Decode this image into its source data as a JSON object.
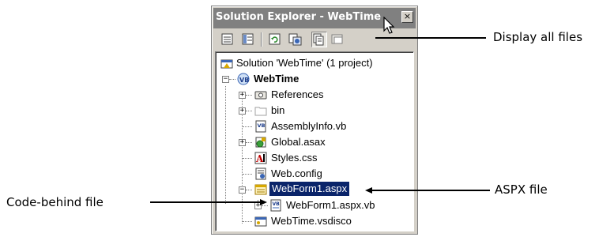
{
  "window": {
    "title": "Solution Explorer - WebTime",
    "close_glyph": "×"
  },
  "toolbar": {
    "buttons": [
      "properties-icon",
      "show-details-icon",
      "refresh-icon",
      "copy-project-icon",
      "display-all-files-icon",
      "nest-related-files-icon"
    ]
  },
  "tree": {
    "solution": "Solution 'WebTime' (1 project)",
    "project": "WebTime",
    "items": {
      "references": "References",
      "bin": "bin",
      "assemblyinfo": "AssemblyInfo.vb",
      "global": "Global.asax",
      "styles": "Styles.css",
      "webconfig": "Web.config",
      "webform": "WebForm1.aspx",
      "webformvb": "WebForm1.aspx.vb",
      "vsdisco": "WebTime.vsdisco"
    },
    "expand_glyph": "+",
    "collapse_glyph": "−"
  },
  "callouts": {
    "display_all_files": "Display all files",
    "aspx_file": "ASPX file",
    "code_behind": "Code-behind file"
  },
  "colors": {
    "selection": "#0a246a",
    "titlebar": "#808080",
    "chrome": "#d4d0c8"
  }
}
